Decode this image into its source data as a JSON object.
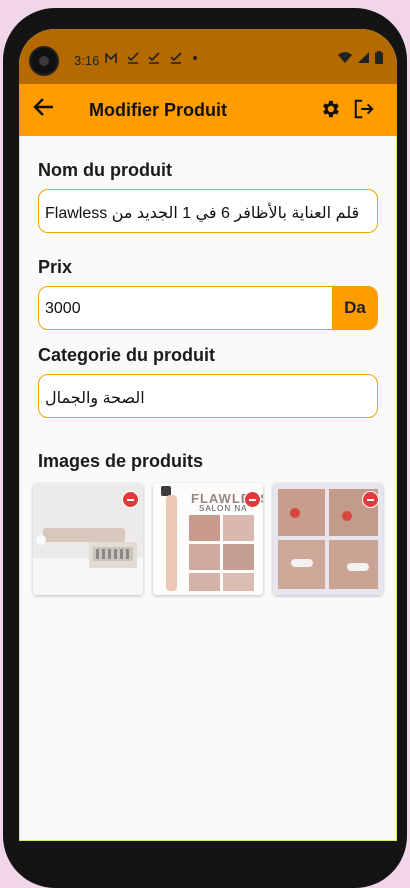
{
  "status_bar": {
    "time": "3:16",
    "notification_icons": [
      "mail-icon",
      "check-icon",
      "check-icon",
      "check-icon",
      "dot-icon"
    ],
    "right_icons": [
      "wifi-icon",
      "signal-icon",
      "battery-icon"
    ]
  },
  "app_bar": {
    "title": "Modifier Produit",
    "back_icon": "arrow-left-icon",
    "settings_icon": "gear-icon",
    "logout_icon": "logout-icon"
  },
  "form": {
    "name_label": "Nom du produit",
    "name_value": "Flawless قلم العناية بالأظافر 6 في 1 الجديد من",
    "price_label": "Prix",
    "price_value": "3000",
    "price_unit": "Da",
    "category_label": "Categorie du produit",
    "category_value": "الصحة والجمال"
  },
  "images": {
    "label": "Images de produits",
    "items": [
      {
        "name": "product-image-1",
        "remove_icon": "minus-circle-icon"
      },
      {
        "name": "product-image-2",
        "caption_1": "FLAWLESS",
        "caption_2": "SALON NA",
        "remove_icon": "minus-circle-icon"
      },
      {
        "name": "product-image-3",
        "remove_icon": "minus-circle-icon"
      }
    ]
  },
  "colors": {
    "accent": "#ff9c00",
    "status_bar": "#b56a00",
    "remove": "#e03a3a"
  }
}
